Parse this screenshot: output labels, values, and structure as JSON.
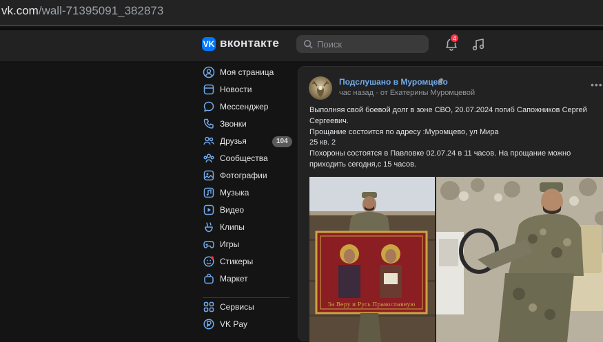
{
  "browser": {
    "url_host": "vk.com",
    "url_path": "/wall-71395091_382873"
  },
  "header": {
    "logo_text": "вконтакте",
    "search_placeholder": "Поиск",
    "notification_count": "4"
  },
  "sidebar": {
    "items": [
      {
        "label": "Моя страница",
        "icon": "user-circle-icon"
      },
      {
        "label": "Новости",
        "icon": "news-icon"
      },
      {
        "label": "Мессенджер",
        "icon": "chat-icon"
      },
      {
        "label": "Звонки",
        "icon": "phone-icon"
      },
      {
        "label": "Друзья",
        "icon": "friends-icon",
        "count": "104"
      },
      {
        "label": "Сообщества",
        "icon": "communities-icon"
      },
      {
        "label": "Фотографии",
        "icon": "photos-icon"
      },
      {
        "label": "Музыка",
        "icon": "music-icon"
      },
      {
        "label": "Видео",
        "icon": "video-icon"
      },
      {
        "label": "Клипы",
        "icon": "clips-icon"
      },
      {
        "label": "Игры",
        "icon": "gamepad-icon"
      },
      {
        "label": "Стикеры",
        "icon": "sticker-icon"
      },
      {
        "label": "Маркет",
        "icon": "market-bag-icon"
      },
      {
        "label": "Сервисы",
        "icon": "services-grid-icon"
      },
      {
        "label": "VK Pay",
        "icon": "vkpay-icon"
      }
    ]
  },
  "post": {
    "author": "Подслушано в Муромцево",
    "time": "час назад",
    "from": "· от Екатерины Муромцевой",
    "lines": [
      "Выполняя свой боевой долг в зоне СВО, 20.07.2024 погиб Сапожников Сергей Сергеевич.",
      "Прощание состоится по адресу :Муромцево, ул Мира",
      "25 кв. 2",
      "Похороны состоятся в Павловке 02.07.24 в 11 часов. На прощание можно приходить сегодня,с 15 часов."
    ],
    "banner_text": "За Веру и Русь Православную"
  },
  "colors": {
    "accent": "#0077ff",
    "link": "#71aaeb",
    "badge": "#ff3347"
  }
}
